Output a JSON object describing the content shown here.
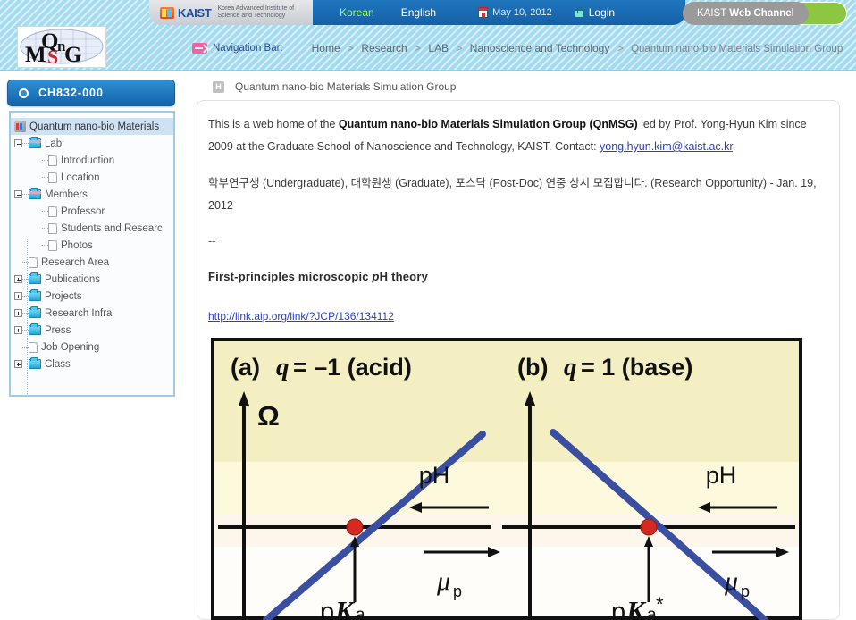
{
  "header": {
    "kaist": {
      "logo_icon": "kaist-tv-icon",
      "brand": "KAIST",
      "subtitle_line1": "Korea Advanced Institute of",
      "subtitle_line2": "Science and Technology"
    },
    "languages": [
      {
        "label": "Korean",
        "active": true
      },
      {
        "label": "English",
        "active": false
      }
    ],
    "date": "May 10, 2012",
    "date_icon": "calendar-icon",
    "login": "Login",
    "login_icon": "lock-icon",
    "web_channel": {
      "prefix": "KAIST",
      "bold": "Web Channel"
    },
    "site_logo_alt": "QnMSG"
  },
  "navigation": {
    "icon": "arrow-right-icon",
    "label": "Navigation Bar:",
    "separator": ">",
    "breadcrumb": [
      "Home",
      "Research",
      "LAB",
      "Nanoscience and Technology",
      "Quantum nano-bio Materials Simulation Group"
    ]
  },
  "sidebar": {
    "header_title": "CH832-000",
    "header_icon": "circle-icon",
    "items": [
      {
        "label": "Quantum nano-bio Materials",
        "icon": "globe-icon",
        "depth": 0,
        "selected": true,
        "toggle": "none"
      },
      {
        "label": "Lab",
        "icon": "folder-open-icon",
        "depth": 1,
        "selected": false,
        "toggle": "minus"
      },
      {
        "label": "Introduction",
        "icon": "document-icon",
        "depth": 2,
        "selected": false,
        "toggle": "none"
      },
      {
        "label": "Location",
        "icon": "document-icon",
        "depth": 2,
        "selected": false,
        "toggle": "none"
      },
      {
        "label": "Members",
        "icon": "folder-open-icon",
        "depth": 1,
        "selected": false,
        "toggle": "minus"
      },
      {
        "label": "Professor",
        "icon": "document-icon",
        "depth": 2,
        "selected": false,
        "toggle": "none"
      },
      {
        "label": "Students and Researc",
        "icon": "document-icon",
        "depth": 2,
        "selected": false,
        "toggle": "none"
      },
      {
        "label": "Photos",
        "icon": "document-icon",
        "depth": 2,
        "selected": false,
        "toggle": "none"
      },
      {
        "label": "Research Area",
        "icon": "document-icon",
        "depth": 1,
        "selected": false,
        "toggle": "none"
      },
      {
        "label": "Publications",
        "icon": "folder-icon",
        "depth": 1,
        "selected": false,
        "toggle": "plus"
      },
      {
        "label": "Projects",
        "icon": "folder-icon",
        "depth": 1,
        "selected": false,
        "toggle": "plus"
      },
      {
        "label": "Research Infra",
        "icon": "folder-icon",
        "depth": 1,
        "selected": false,
        "toggle": "plus"
      },
      {
        "label": "Press",
        "icon": "folder-icon",
        "depth": 1,
        "selected": false,
        "toggle": "plus"
      },
      {
        "label": "Job Opening",
        "icon": "document-icon",
        "depth": 1,
        "selected": false,
        "toggle": "none"
      },
      {
        "label": "Class",
        "icon": "folder-icon",
        "depth": 1,
        "selected": false,
        "toggle": "plus"
      }
    ]
  },
  "main": {
    "page_title": "Quantum nano-bio Materials Simulation Group",
    "page_title_icon": "home-icon",
    "intro": {
      "part1": "This is a web home of the ",
      "bold1": "Quantum nano-bio Materials Simulation Group (QnMSG)",
      "part2": " led by Prof. Yong-Hyun Kim since 2009 at the Graduate School of Nanoscience and Technology, KAIST. Contact: ",
      "email": "yong.hyun.kim@kaist.ac.kr",
      "part3": "."
    },
    "recruit": "학부연구생 (Undergraduate), 대학원생 (Graduate), 포스닥 (Post-Doc) 연중 상시 모집합니다. (Research Opportunity) - Jan. 19, 2012",
    "divider": "--",
    "highlight_title": "First-principles microscopic pH theory",
    "link": "http://link.aip.org/link/?JCP/136/134112"
  },
  "chart_data": {
    "type": "line",
    "title": "First-principles microscopic pH theory",
    "panels": [
      {
        "id": "a",
        "label": "(a)",
        "condition": "q = −1 (acid)",
        "ylabel": "Ω",
        "slope": "positive",
        "crossing_label": "pK",
        "crossing_sub": "a",
        "crossing_star": "",
        "axis_arrows": [
          {
            "label": "pH",
            "direction": "left"
          },
          {
            "label": "μ",
            "sub": "p",
            "direction": "right"
          }
        ],
        "marker": {
          "color": "#d42a20",
          "x_label": "pKa",
          "y_value": 0
        }
      },
      {
        "id": "b",
        "label": "(b)",
        "condition": "q = 1 (base)",
        "ylabel": "",
        "slope": "negative",
        "crossing_label": "pK",
        "crossing_sub": "a",
        "crossing_star": "*",
        "axis_arrows": [
          {
            "label": "pH",
            "direction": "left"
          },
          {
            "label": "μ",
            "sub": "p",
            "direction": "right"
          }
        ],
        "marker": {
          "color": "#d42a20",
          "x_label": "pKa*",
          "y_value": 0
        }
      }
    ],
    "background_bands": [
      "#f4efc2",
      "#fcf9dd",
      "#fdf6ea",
      "#fefdfa"
    ],
    "line_color": "#3b4fa0",
    "axis_color": "#111111",
    "xlabel": "",
    "ylabel": "Ω",
    "grid": false,
    "legend": "none"
  },
  "colors": {
    "header_blue": "#1f76bd",
    "stripe_bg": "#a6dcf0",
    "accent_green": "#8dc63f",
    "link_blue": "#2b40c8",
    "sidebar_border": "#9ecbe8",
    "marker_red": "#d42a20",
    "curve_blue": "#3b4fa0"
  }
}
